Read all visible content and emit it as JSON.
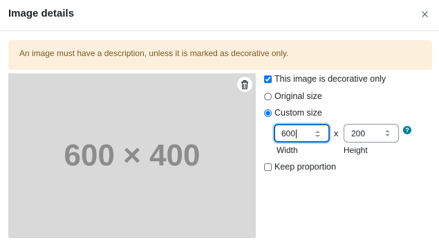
{
  "header": {
    "title": "Image details",
    "close_label": "×"
  },
  "alert": {
    "text": "An image must have a description, unless it is marked as decorative only."
  },
  "preview": {
    "placeholder_text": "600 × 400",
    "delete_icon": "trash-icon"
  },
  "options": {
    "decorative": {
      "label": "This image is decorative only",
      "checked": true
    },
    "original_size": {
      "label": "Original size",
      "selected": false
    },
    "custom_size": {
      "label": "Custom size",
      "selected": true
    },
    "keep_proportion": {
      "label": "Keep proportion",
      "checked": false
    }
  },
  "size": {
    "width_value": "600",
    "height_value": "200",
    "separator": "x",
    "width_label": "Width",
    "height_label": "Height",
    "help_label": "?"
  },
  "colors": {
    "accent": "#0f6cbf",
    "help": "#008196",
    "alert_bg": "#fcefdc"
  }
}
